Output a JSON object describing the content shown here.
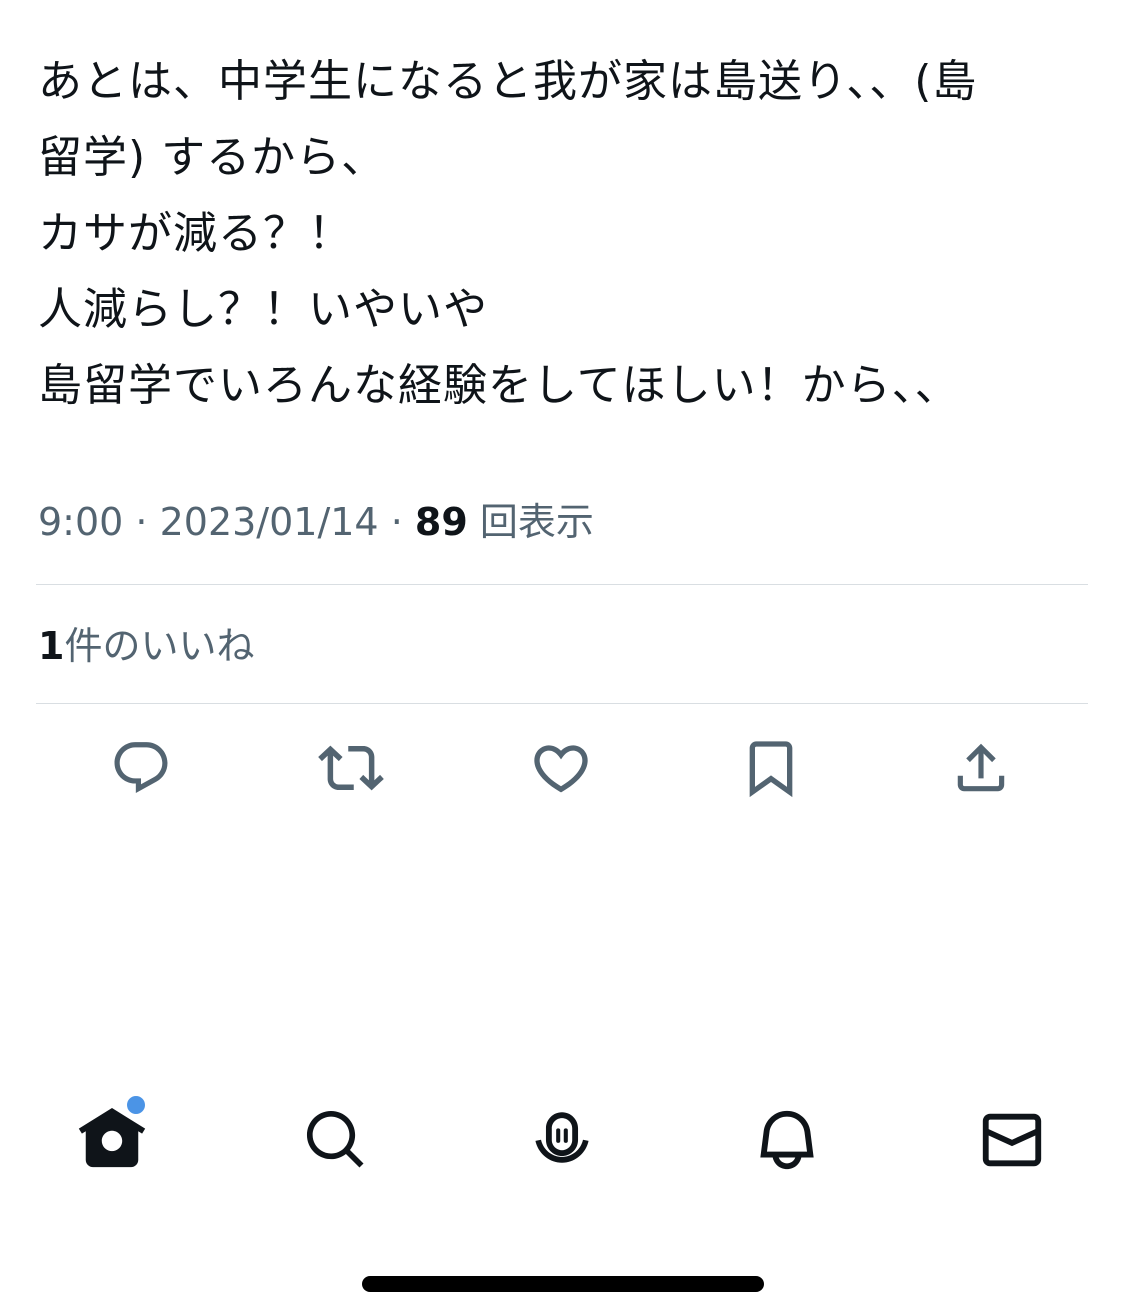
{
  "tweet": {
    "lines": [
      "あとは、中学生になると我が家は島送り、、(島",
      "留学) するから、",
      "カサが減る？！",
      "人減らし？！いやいや",
      "島留学でいろんな経験をしてほしい！から、、"
    ],
    "time": "9:00",
    "separator": " · ",
    "date": "2023/01/14",
    "views_count": "89",
    "views_label": "回表示"
  },
  "likes": {
    "count": "1",
    "label": "件のいいね"
  },
  "actions": {
    "icons": [
      "reply-icon",
      "retweet-icon",
      "like-icon",
      "bookmark-icon",
      "share-icon"
    ]
  },
  "tab_bar": {
    "icons": [
      "home-icon",
      "search-icon",
      "spaces-icon",
      "notifications-icon",
      "messages-icon"
    ],
    "home_badge_color": "#4b94e6"
  },
  "colors": {
    "text": "#0f1419",
    "secondary": "#536471",
    "divider": "#d9dee2"
  }
}
